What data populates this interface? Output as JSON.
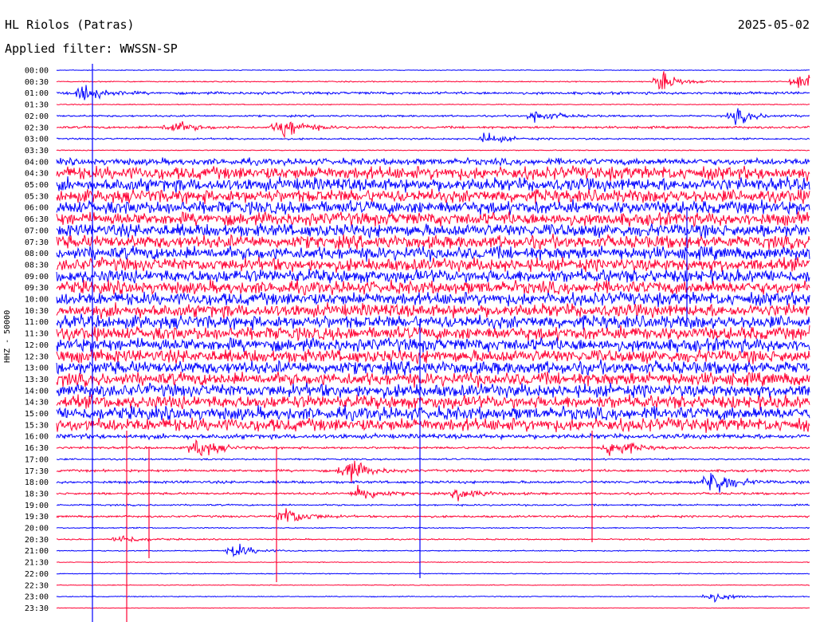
{
  "header": {
    "station": "HL Riolos (Patras)",
    "date": "2025-05-02",
    "filter_label": "Applied filter:",
    "filter_value": "WWSSN-SP"
  },
  "chart_data": {
    "type": "line",
    "title": "HL Riolos (Patras)",
    "channel_label": "HHZ - 50000",
    "time_labels": [
      "00:00",
      "00:30",
      "01:00",
      "01:30",
      "02:00",
      "02:30",
      "03:00",
      "03:30",
      "04:00",
      "04:30",
      "05:00",
      "05:30",
      "06:00",
      "06:30",
      "07:00",
      "07:30",
      "08:00",
      "08:30",
      "09:00",
      "09:30",
      "10:00",
      "10:30",
      "11:00",
      "11:30",
      "12:00",
      "12:30",
      "13:00",
      "13:30",
      "14:00",
      "14:30",
      "15:00",
      "15:30",
      "16:00",
      "16:30",
      "17:00",
      "17:30",
      "18:00",
      "18:30",
      "19:00",
      "19:30",
      "20:00",
      "20:30",
      "21:00",
      "21:30",
      "22:00",
      "22:30",
      "23:00",
      "23:30"
    ],
    "trace_colors": [
      "#0000ff",
      "#ff0033"
    ],
    "relative_amplitude": [
      0.4,
      0.6,
      1.4,
      0.5,
      1.0,
      1.2,
      0.9,
      0.5,
      3.5,
      7,
      7,
      7,
      7,
      7,
      7,
      7,
      7,
      7,
      7,
      7,
      7,
      7,
      7,
      7,
      7,
      7,
      7,
      7,
      7,
      7,
      7,
      7,
      2.5,
      1.2,
      0.9,
      1.3,
      1.4,
      1.2,
      0.9,
      1.1,
      0.6,
      0.7,
      0.6,
      0.4,
      0.5,
      0.4,
      0.5,
      0.3
    ],
    "events": [
      {
        "time": "00:30",
        "minute": 24,
        "amplitude": 2.0
      },
      {
        "time": "00:30",
        "minute": 29.5,
        "amplitude": 2.5
      },
      {
        "time": "01:00",
        "minute": 1,
        "amplitude": 1.8
      },
      {
        "time": "02:00",
        "minute": 19,
        "amplitude": 1.5
      },
      {
        "time": "02:00",
        "minute": 27,
        "amplitude": 1.6
      },
      {
        "time": "02:30",
        "minute": 4.5,
        "amplitude": 1.6
      },
      {
        "time": "02:30",
        "minute": 9,
        "amplitude": 1.5
      },
      {
        "time": "02:30",
        "minute": 8.8,
        "amplitude": 1.2
      },
      {
        "time": "03:00",
        "minute": 17,
        "amplitude": 1.2
      },
      {
        "time": "16:30",
        "minute": 5.5,
        "amplitude": 2.5
      },
      {
        "time": "16:30",
        "minute": 22,
        "amplitude": 2.5
      },
      {
        "time": "17:30",
        "minute": 11.5,
        "amplitude": 2.8
      },
      {
        "time": "18:00",
        "minute": 26,
        "amplitude": 3.5
      },
      {
        "time": "18:30",
        "minute": 12,
        "amplitude": 1.8
      },
      {
        "time": "18:30",
        "minute": 16,
        "amplitude": 1.5
      },
      {
        "time": "19:30",
        "minute": 9,
        "amplitude": 2.4
      },
      {
        "time": "20:30",
        "minute": 2.5,
        "amplitude": 1.0
      },
      {
        "time": "21:00",
        "minute": 7,
        "amplitude": 1.6
      },
      {
        "time": "23:00",
        "minute": 26,
        "amplitude": 1.2
      }
    ],
    "grid": false,
    "legend": "none"
  }
}
